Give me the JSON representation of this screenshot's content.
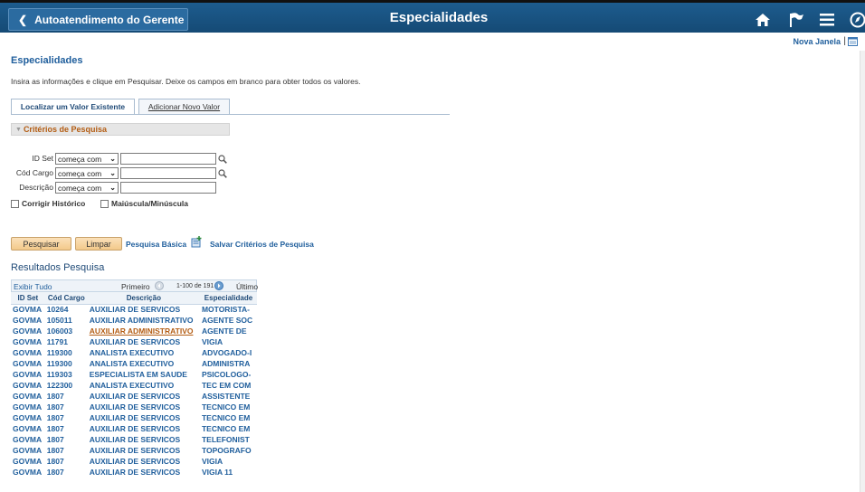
{
  "banner": {
    "back_label": "Autoatendimento do Gerente",
    "title": "Especialidades",
    "icons": [
      "home-icon",
      "flag-icon",
      "menu-icon",
      "navbar-icon"
    ]
  },
  "nova_janela": "Nova Janela",
  "page_title": "Especialidades",
  "instructions": "Insira as informações e clique em Pesquisar. Deixe os campos em branco para obter todos os valores.",
  "tabs": [
    {
      "label": "Localizar um Valor Existente",
      "active": true
    },
    {
      "label": "Adicionar Novo Valor",
      "active": false
    }
  ],
  "criteria": {
    "header": "Critérios de Pesquisa",
    "fields": [
      {
        "label": "ID Set",
        "operator": "começa com",
        "value": ""
      },
      {
        "label": "Cód Cargo",
        "operator": "começa com",
        "value": ""
      },
      {
        "label": "Descrição",
        "operator": "começa com",
        "value": ""
      }
    ],
    "checkboxes": [
      {
        "label": "Corrigir Histórico",
        "checked": false
      },
      {
        "label": "Maiúscula/Minúscula",
        "checked": false
      }
    ]
  },
  "actions": {
    "search": "Pesquisar",
    "clear": "Limpar",
    "basic_search": "Pesquisa Básica",
    "save_criteria": "Salvar Critérios de Pesquisa"
  },
  "results": {
    "title": "Resultados Pesquisa",
    "show_all": "Exibir Tudo",
    "first": "Primeiro",
    "range": "1-100 de 191",
    "last": "Último",
    "columns": [
      "ID Set",
      "Cód Cargo",
      "Descrição",
      "Especialidade"
    ],
    "rows": [
      [
        "GOVMA",
        "10264",
        "AUXILIAR DE SERVICOS",
        "MOTORISTA-"
      ],
      [
        "GOVMA",
        "105011",
        "AUXILIAR ADMINISTRATIVO",
        "AGENTE SOC"
      ],
      [
        "GOVMA",
        "106003",
        "AUXILIAR ADMINISTRATIVO",
        "AGENTE DE"
      ],
      [
        "GOVMA",
        "11791",
        "AUXILIAR DE SERVICOS",
        "VIGIA"
      ],
      [
        "GOVMA",
        "119300",
        "ANALISTA EXECUTIVO",
        "ADVOGADO-I"
      ],
      [
        "GOVMA",
        "119300",
        "ANALISTA EXECUTIVO",
        "ADMINISTRA"
      ],
      [
        "GOVMA",
        "119303",
        "ESPECIALISTA EM SAUDE",
        "PSICOLOGO-"
      ],
      [
        "GOVMA",
        "122300",
        "ANALISTA EXECUTIVO",
        "TEC EM COM"
      ],
      [
        "GOVMA",
        "1807",
        "AUXILIAR DE SERVICOS",
        "ASSISTENTE"
      ],
      [
        "GOVMA",
        "1807",
        "AUXILIAR DE SERVICOS",
        "TECNICO EM"
      ],
      [
        "GOVMA",
        "1807",
        "AUXILIAR DE SERVICOS",
        "TECNICO EM"
      ],
      [
        "GOVMA",
        "1807",
        "AUXILIAR DE SERVICOS",
        "TECNICO EM"
      ],
      [
        "GOVMA",
        "1807",
        "AUXILIAR DE SERVICOS",
        "TELEFONIST"
      ],
      [
        "GOVMA",
        "1807",
        "AUXILIAR DE SERVICOS",
        "TOPOGRAFO"
      ],
      [
        "GOVMA",
        "1807",
        "AUXILIAR DE SERVICOS",
        "VIGIA"
      ],
      [
        "GOVMA",
        "1807",
        "AUXILIAR DE SERVICOS",
        "VIGIA 11"
      ]
    ]
  },
  "colors": {
    "banner": "#1d5c8e",
    "link": "#1f5e9c",
    "accent_orange": "#b35c12",
    "button": "#f3c98a"
  }
}
